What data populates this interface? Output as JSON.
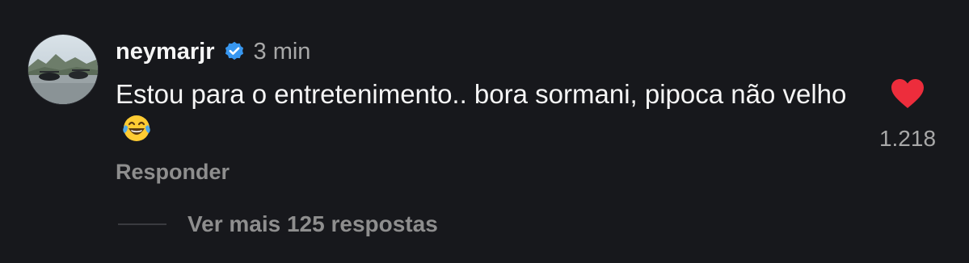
{
  "comment": {
    "username": "neymarjr",
    "verified_icon": "verified-badge-icon",
    "time": "3 min",
    "text": "Estou para o entretenimento.. bora sormani, pipoca não velho",
    "emoji_icon": "face-with-tears-of-joy-icon",
    "reply_label": "Responder",
    "like_icon": "heart-icon",
    "like_count": "1.218",
    "view_replies_label": "Ver mais 125 respostas"
  },
  "colors": {
    "background": "#17181c",
    "text": "#f5f5f5",
    "secondary_text": "#a8a8a8",
    "muted_text": "#8e8e8e",
    "verified": "#3897f0",
    "heart": "#ed2d3c"
  }
}
